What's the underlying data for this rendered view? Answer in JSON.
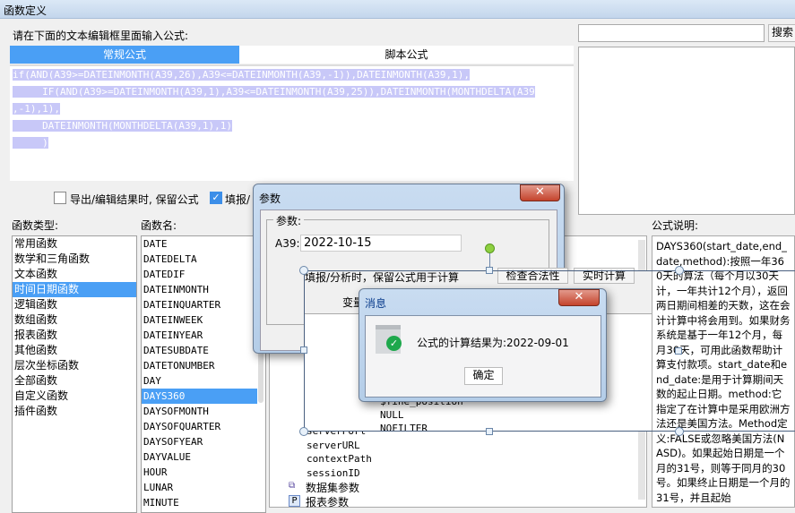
{
  "window": {
    "title": "函数定义"
  },
  "editor": {
    "prompt": "请在下面的文本编辑框里面输入公式:",
    "tabs": [
      {
        "label": "常规公式",
        "active": true
      },
      {
        "label": "脚本公式",
        "active": false
      }
    ],
    "lines": [
      "if(AND(A39>=DATEINMONTH(A39,26),A39<=DATEINMONTH(A39,-1)),DATEINMONTH(A39,1),",
      "     IF(AND(A39>=DATEINMONTH(A39,1),A39<=DATEINMONTH(A39,25)),DATEINMONTH(MONTHDELTA(A39",
      ",-1),1),",
      "     DATEINMONTH(MONTHDELTA(A39,1),1)",
      "     )",
      ")"
    ]
  },
  "search": {
    "value": "",
    "button": "搜索"
  },
  "options": {
    "keep_formula_export": {
      "label": "导出/编辑结果时, 保留公式",
      "checked": false
    },
    "keep_formula_fill": {
      "label": "填报/",
      "checked": true
    },
    "keep_formula_fill_full": "填报/分析时，保留公式用于计算",
    "check_validity": "检查合法性",
    "realtime_calc": "实时计算",
    "variables_label": "变量"
  },
  "categories": {
    "label": "函数类型:",
    "items": [
      "常用函数",
      "数学和三角函数",
      "文本函数",
      "时间日期函数",
      "逻辑函数",
      "数组函数",
      "报表函数",
      "其他函数",
      "层次坐标函数",
      "全部函数",
      "自定义函数",
      "插件函数"
    ],
    "selected": "时间日期函数"
  },
  "functions": {
    "label": "函数名:",
    "items": [
      "DATE",
      "DATEDELTA",
      "DATEDIF",
      "DATEINMONTH",
      "DATEINQUARTER",
      "DATEINWEEK",
      "DATEINYEAR",
      "DATESUBDATE",
      "DATETONUMBER",
      "DAY",
      "DAYS360",
      "DAYSOFMONTH",
      "DAYSOFQUARTER",
      "DAYSOFYEAR",
      "DAYVALUE",
      "HOUR",
      "LUNAR",
      "MINUTE"
    ],
    "selected": "DAYS360"
  },
  "tree": {
    "items": [
      "$fine_position",
      "NULL",
      "NOFILTER",
      "serverPort",
      "serverURL",
      "contextPath",
      "sessionID"
    ],
    "dataset_params": "数据集参数",
    "report_params": "报表参数"
  },
  "description": {
    "label": "公式说明:",
    "text": "DAYS360(start_date,end_date,method):按照一年360天的算法（每个月以30天计，一年共计12个月），返回两日期间相差的天数，这在会计计算中将会用到。如果财务系统是基于一年12个月，每月30天，可用此函数帮助计算支付款项。start_date和end_date:是用于计算期间天数的起止日期。method:它指定了在计算中是采用欧洲方法还是美国方法。Method定义:FALSE或忽略美国方法(NASD)。如果起始日期是一个月的31号，则等于同月的30号。如果终止日期是一个月的31号，并且起始"
  },
  "param_dialog": {
    "title": "参数",
    "group": "参数:",
    "field_label": "A39:",
    "field_value": "2022-10-15",
    "close": "x"
  },
  "message_dialog": {
    "title": "消息",
    "message": "公式的计算结果为:2022-09-01",
    "ok": "确定",
    "close": "x"
  }
}
